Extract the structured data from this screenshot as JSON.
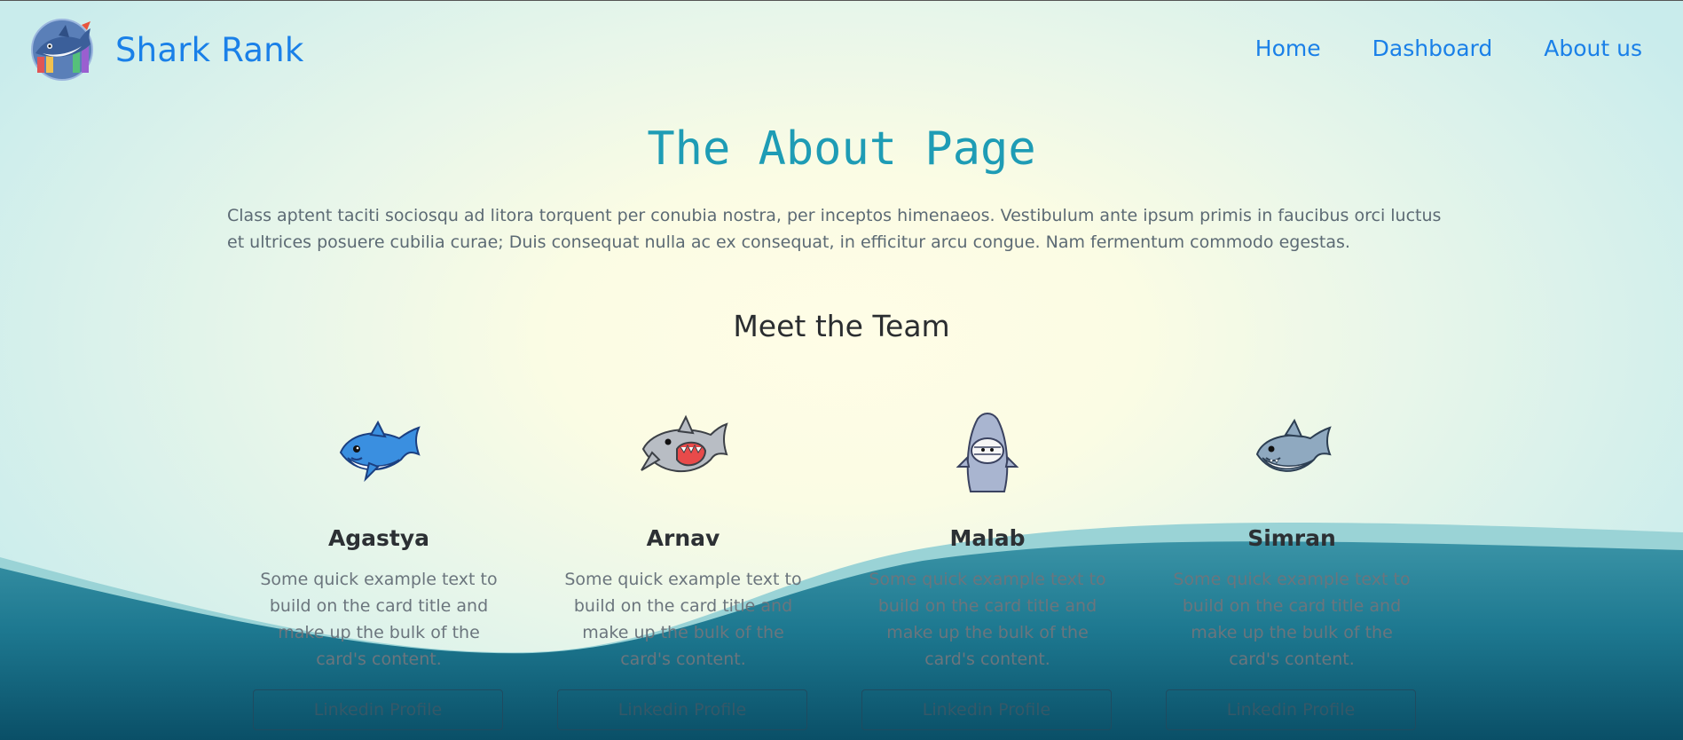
{
  "colors": {
    "brand_blue": "#1a80e8",
    "title_teal": "#1e9cb5",
    "wave_light": "#8ecfd6",
    "wave_dark": "#0d5870"
  },
  "navbar": {
    "brand": "Shark Rank",
    "logo_icon": "shark-logo-icon",
    "links": [
      "Home",
      "Dashboard",
      "About us"
    ]
  },
  "page": {
    "title": "The About Page",
    "intro": "Class aptent taciti sociosqu ad litora torquent per conubia nostra, per inceptos himenaeos. Vestibulum ante ipsum primis in faucibus orci luctus et ultrices posuere cubilia curae; Duis consequat nulla ac ex consequat, in efficitur arcu congue. Nam fermentum commodo egestas.",
    "team_heading": "Meet the Team"
  },
  "team": [
    {
      "name": "Agastya",
      "text": "Some quick example text to build on the card title and make up the bulk of the card's content.",
      "button": "Linkedin Profile",
      "icon": "blue-shark-icon"
    },
    {
      "name": "Arnav",
      "text": "Some quick example text to build on the card title and make up the bulk of the card's content.",
      "button": "Linkedin Profile",
      "icon": "grey-shark-open-mouth-icon"
    },
    {
      "name": "Malab",
      "text": "Some quick example text to build on the card title and make up the bulk of the card's content.",
      "button": "Linkedin Profile",
      "icon": "shark-costume-icon"
    },
    {
      "name": "Simran",
      "text": "Some quick example text to build on the card title and make up the bulk of the card's content.",
      "button": "Linkedin Profile",
      "icon": "smiling-shark-icon"
    }
  ]
}
